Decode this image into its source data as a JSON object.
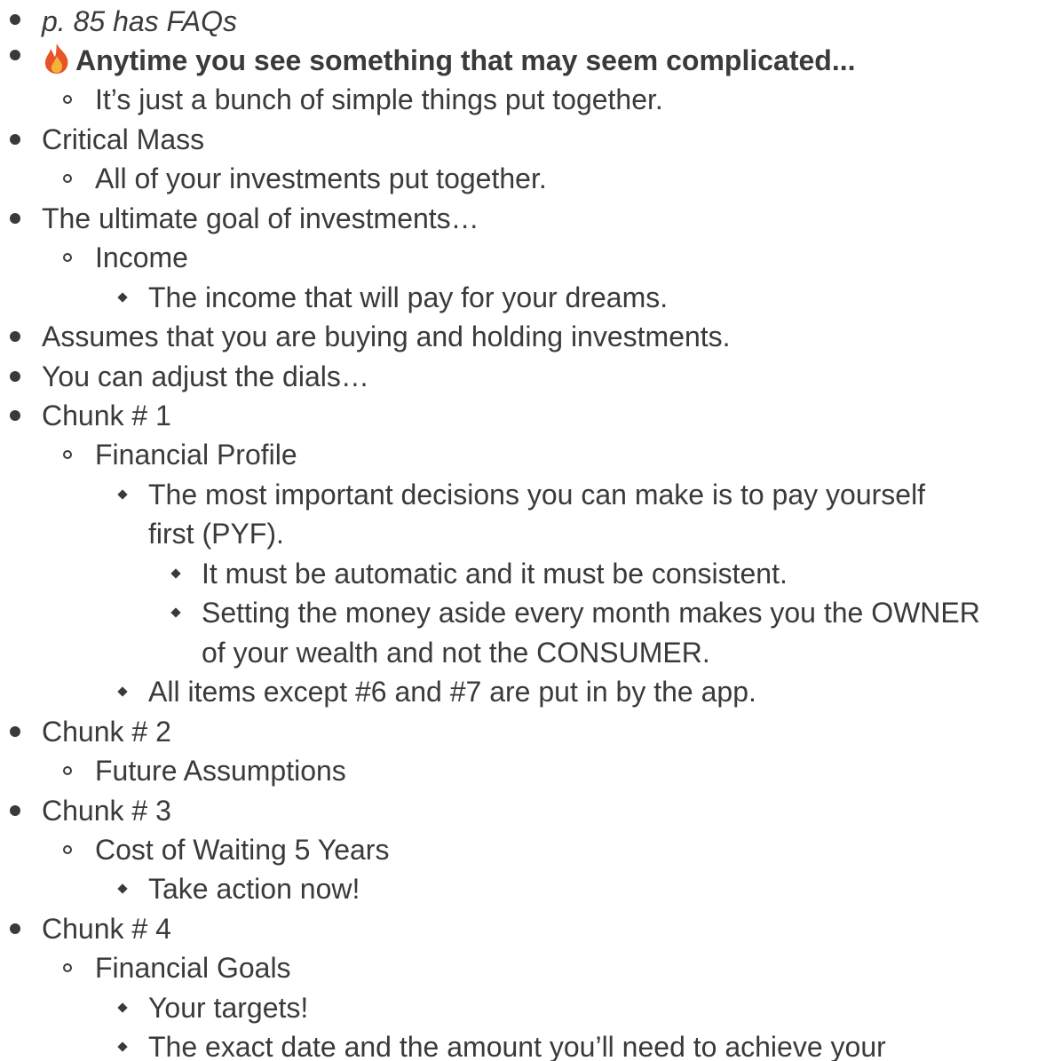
{
  "outline": {
    "items": [
      {
        "text": "p. 85 has FAQs",
        "level": 1,
        "style": "italic"
      },
      {
        "text": "Anytime you see something that may seem complicated...",
        "level": 1,
        "style": "bold",
        "icon": "fire-icon"
      },
      {
        "text": "It’s just a bunch of simple things put together.",
        "level": 2
      },
      {
        "text": "Critical Mass",
        "level": 1
      },
      {
        "text": "All of your investments put together.",
        "level": 2
      },
      {
        "text": "The ultimate goal of investments…",
        "level": 1
      },
      {
        "text": "Income",
        "level": 2
      },
      {
        "text": "The income that will pay for your dreams.",
        "level": 3
      },
      {
        "text": "Assumes that you are buying and holding investments.",
        "level": 1
      },
      {
        "text": "You can adjust the dials…",
        "level": 1
      },
      {
        "text": "Chunk # 1",
        "level": 1
      },
      {
        "text": "Financial Profile",
        "level": 2
      },
      {
        "text": "The most important decisions you can make is to pay yourself",
        "level": 3
      },
      {
        "text": "first (PYF).",
        "level": 3,
        "continuation": true
      },
      {
        "text": "It must be automatic and it must be consistent.",
        "level": 4
      },
      {
        "text": "Setting the money aside every month makes you the OWNER",
        "level": 4
      },
      {
        "text": "of your wealth and not the CONSUMER.",
        "level": 4,
        "continuation": true
      },
      {
        "text": "All items except #6 and #7 are put in by the app.",
        "level": 3
      },
      {
        "text": "Chunk # 2",
        "level": 1
      },
      {
        "text": "Future Assumptions",
        "level": 2
      },
      {
        "text": "Chunk # 3",
        "level": 1
      },
      {
        "text": "Cost of Waiting 5 Years",
        "level": 2
      },
      {
        "text": "Take action now!",
        "level": 3
      },
      {
        "text": "Chunk # 4",
        "level": 1
      },
      {
        "text": "Financial Goals",
        "level": 2
      },
      {
        "text": "Your targets!",
        "level": 3
      },
      {
        "text": "The exact date and the amount you’ll need to achieve your",
        "level": 3
      }
    ]
  },
  "colors": {
    "text": "#3a3a3c",
    "background": "#ffffff"
  }
}
